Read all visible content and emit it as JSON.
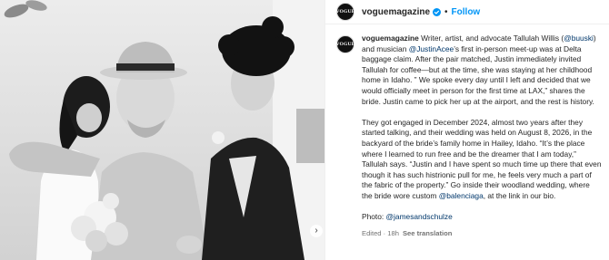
{
  "post": {
    "username": "voguemagazine",
    "logo_text": "VOGUE",
    "follow_label": "Follow",
    "separator": "•"
  },
  "caption": {
    "username": "voguemagazine",
    "p1_a": " Writer, artist, and advocate Tallulah Willis (",
    "p1_mention1": "@buuski",
    "p1_b": ") and musician ",
    "p1_mention2": "@JustinAcee",
    "p1_c": "’s first in-person meet-up was at Delta baggage claim. After the pair matched, Justin immediately invited Tallulah for coffee—but at the time, she was staying at her childhood home in Idaho. ” We spoke every day until I left and decided that we would officially meet in person for the first time at LAX,” shares the bride. Justin came to pick her up at the airport, and the rest is history.",
    "p2_a": "They got engaged in December 2024, almost two years after they started talking, and their wedding was held on August 8, 2026, in the backyard of the bride’s family home in Hailey, Idaho. “It’s the place where I learned to run free and be the dreamer that I am today,” Tallulah says. “Justin and I have spent so much time up there that even though it has such histrionic pull for me, he feels very much a part of the fabric of the property.” Go inside their woodland wedding, where the bride wore custom ",
    "p2_mention": "@balenciaga",
    "p2_b": ", at the link in our bio.",
    "photo_label": "Photo: ",
    "photo_mention": "@jamesandschulze",
    "meta_edited": "Edited · 18h",
    "meta_translation": "See translation"
  },
  "photo": {
    "carousel_icon": "chevron-right-icon"
  },
  "colors": {
    "link": "#0095f6",
    "mention": "#00376b",
    "verified": "#0095f6",
    "muted": "#737373"
  }
}
